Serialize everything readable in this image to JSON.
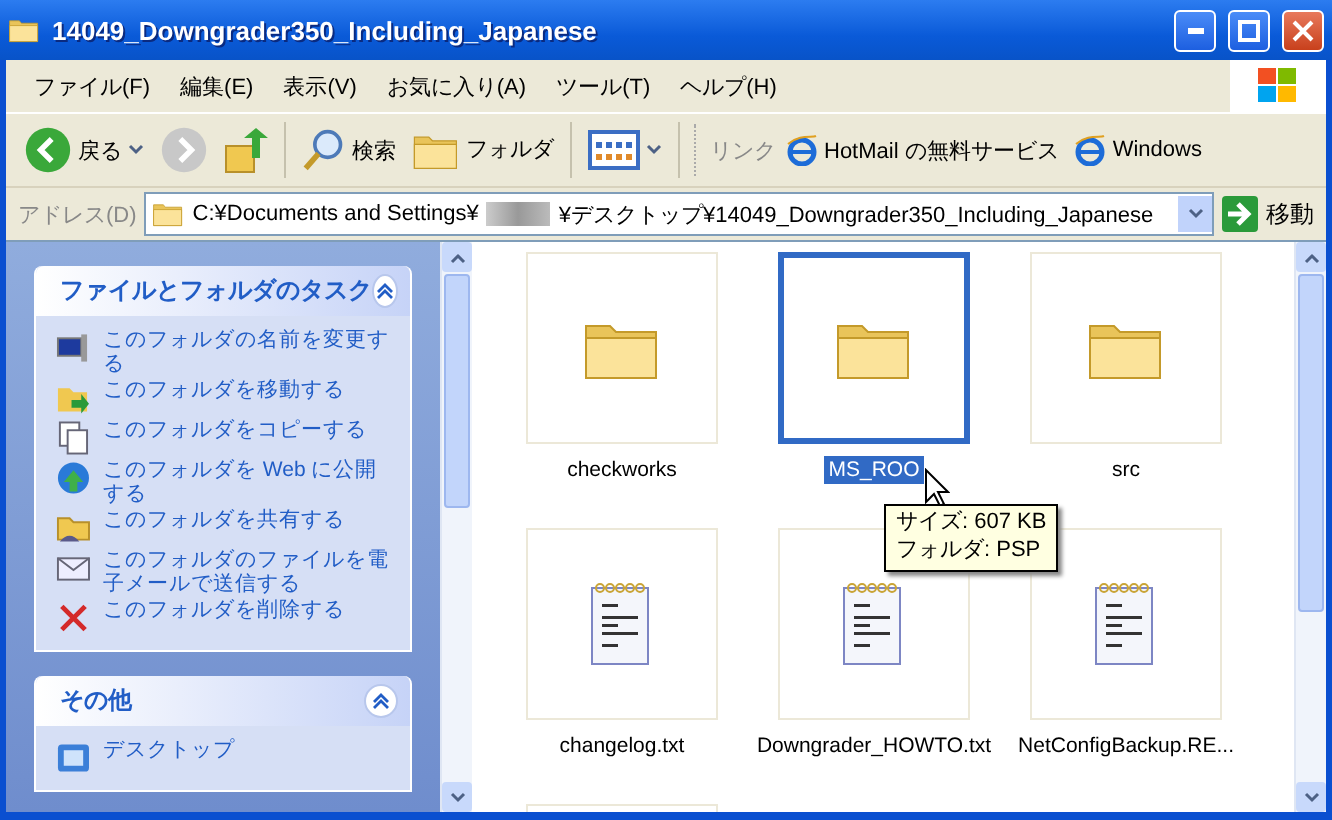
{
  "window": {
    "title": "14049_Downgrader350_Including_Japanese"
  },
  "menu": [
    "ファイル(F)",
    "編集(E)",
    "表示(V)",
    "お気に入り(A)",
    "ツール(T)",
    "ヘルプ(H)"
  ],
  "toolbar": {
    "back": "戻る",
    "forward": {
      "disabled": true
    },
    "search": "検索",
    "folders": "フォルダ",
    "links_label": "リンク",
    "links": [
      "HotMail の無料サービス",
      "Windows"
    ]
  },
  "address": {
    "label": "アドレス(D)",
    "path_start": "C:¥Documents and Settings¥",
    "path_end": "¥デスクトップ¥14049_Downgrader350_Including_Japanese",
    "go": "移動"
  },
  "task_panels": [
    {
      "title": "ファイルとフォルダのタスク",
      "expanded": true,
      "items": [
        {
          "label": "このフォルダの名前を変更する",
          "kind": "rename"
        },
        {
          "label": "このフォルダを移動する",
          "kind": "move"
        },
        {
          "label": "このフォルダをコピーする",
          "kind": "copy"
        },
        {
          "label": "このフォルダを Web に公開する",
          "kind": "web"
        },
        {
          "label": "このフォルダを共有する",
          "kind": "share"
        },
        {
          "label": "このフォルダのファイルを電子メールで送信する",
          "kind": "mail"
        },
        {
          "label": "このフォルダを削除する",
          "kind": "delete"
        }
      ]
    },
    {
      "title": "その他",
      "expanded": true,
      "items": [
        {
          "label": "デスクトップ",
          "kind": "desktop"
        }
      ]
    }
  ],
  "files": [
    {
      "name": "checkworks",
      "kind": "folder",
      "selected": false
    },
    {
      "name": "MS_ROO",
      "kind": "folder",
      "selected": true
    },
    {
      "name": "src",
      "kind": "folder",
      "selected": false
    },
    {
      "name": "changelog.txt",
      "kind": "text",
      "selected": false
    },
    {
      "name": "Downgrader_HOWTO.txt",
      "kind": "text",
      "selected": false
    },
    {
      "name": "NetConfigBackup.RE...",
      "kind": "text",
      "selected": false
    },
    {
      "kind": "cut_off"
    }
  ],
  "tooltip": {
    "lines": [
      "サイズ: 607 KB",
      "フォルダ: PSP"
    ]
  }
}
